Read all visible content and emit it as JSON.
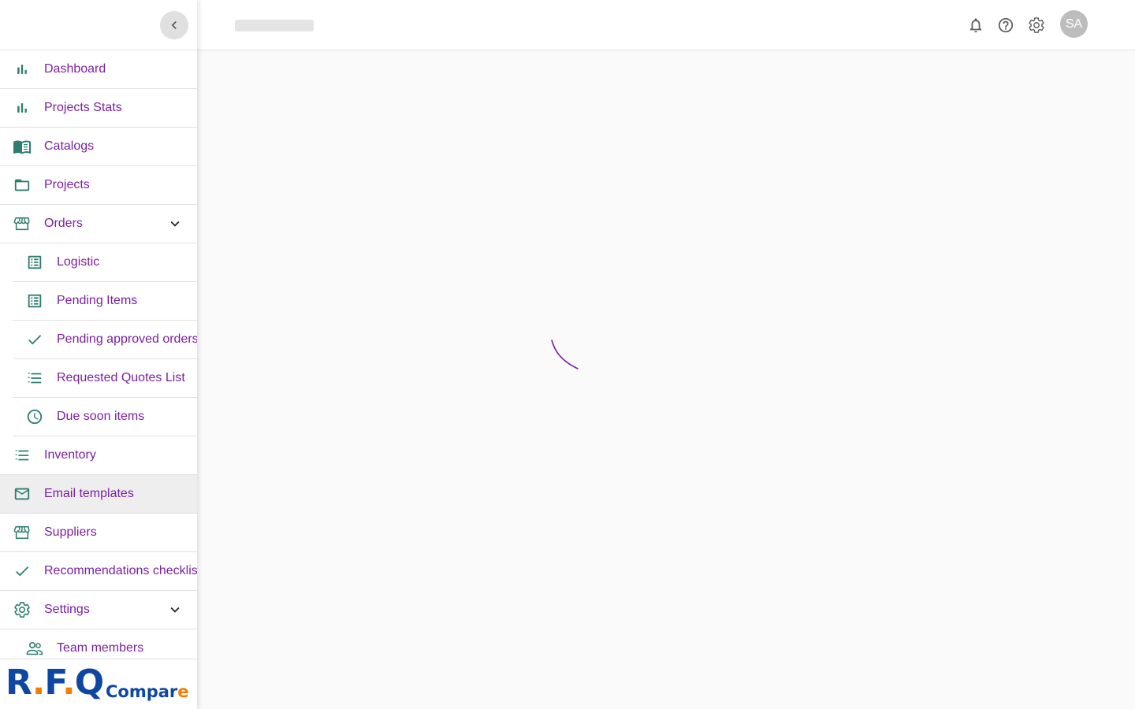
{
  "colors": {
    "icon": "#2e7d6e",
    "label": "#7b1fa2",
    "active_bg": "#eeeeee",
    "spinner": "#7b1fa2",
    "logo_blue": "#0d47a1",
    "logo_orange": "#f57c00"
  },
  "sidebar": {
    "collapse_icon": "chevron-left-icon",
    "items": [
      {
        "label": "Dashboard",
        "icon": "bar-chart-icon"
      },
      {
        "label": "Projects Stats",
        "icon": "bar-chart-icon"
      },
      {
        "label": "Catalogs",
        "icon": "book-open-icon"
      },
      {
        "label": "Projects",
        "icon": "folder-icon"
      },
      {
        "label": "Orders",
        "icon": "storefront-icon",
        "expandable": true
      },
      {
        "label": "Logistic",
        "icon": "list-alt-icon",
        "sub": true
      },
      {
        "label": "Pending Items",
        "icon": "list-alt-icon",
        "sub": true
      },
      {
        "label": "Pending approved orders",
        "icon": "check-icon",
        "sub": true
      },
      {
        "label": "Requested Quotes List",
        "icon": "format-list-icon",
        "sub": true
      },
      {
        "label": "Due soon items",
        "icon": "clock-icon",
        "sub": true
      },
      {
        "label": "Inventory",
        "icon": "format-list-icon"
      },
      {
        "label": "Email templates",
        "icon": "mail-icon",
        "active": true
      },
      {
        "label": "Suppliers",
        "icon": "storefront-icon"
      },
      {
        "label": "Recommendations checklist",
        "icon": "check-icon"
      },
      {
        "label": "Settings",
        "icon": "gear-icon",
        "expandable": true
      },
      {
        "label": "Team members",
        "icon": "people-icon",
        "sub": true
      }
    ],
    "logo": {
      "rfq_r": "R",
      "rfq_f": "F",
      "rfq_q": "Q",
      "dot": ".",
      "compare": "Compar",
      "compare_e": "e"
    }
  },
  "header": {
    "icons": [
      "bell-icon",
      "help-icon",
      "gear-icon"
    ],
    "avatar_initials": "SA"
  },
  "main": {
    "loading": true
  }
}
